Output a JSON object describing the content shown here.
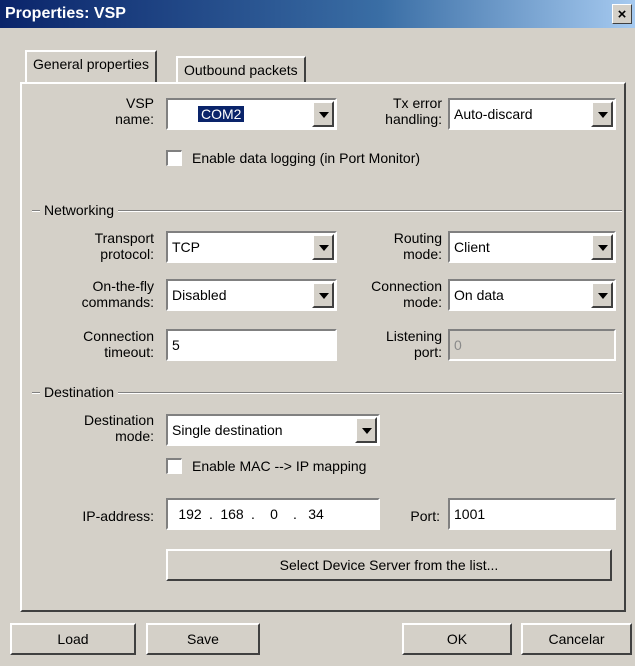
{
  "window": {
    "title": "Properties: VSP",
    "close_glyph": "×"
  },
  "tabs": [
    {
      "label": "General properties",
      "active": true
    },
    {
      "label": "Outbound packets",
      "active": false
    }
  ],
  "general": {
    "vsp_name_label_1": "VSP",
    "vsp_name_label_2": "name:",
    "vsp_name_value": "COM2",
    "tx_error_label_1": "Tx error",
    "tx_error_label_2": "handling:",
    "tx_error_value": "Auto-discard",
    "logging_label": "Enable data logging (in Port Monitor)",
    "logging_checked": false
  },
  "networking": {
    "section_title": "Networking",
    "transport_label_1": "Transport",
    "transport_label_2": "protocol:",
    "transport_value": "TCP",
    "routing_label_1": "Routing",
    "routing_label_2": "mode:",
    "routing_value": "Client",
    "onthefly_label_1": "On-the-fly",
    "onthefly_label_2": "commands:",
    "onthefly_value": "Disabled",
    "connmode_label_1": "Connection",
    "connmode_label_2": "mode:",
    "connmode_value": "On data",
    "timeout_label_1": "Connection",
    "timeout_label_2": "timeout:",
    "timeout_value": "5",
    "listening_label_1": "Listening",
    "listening_label_2": "port:",
    "listening_value": "0"
  },
  "destination": {
    "section_title": "Destination",
    "mode_label_1": "Destination",
    "mode_label_2": "mode:",
    "mode_value": "Single destination",
    "mac_label": "Enable MAC --> IP mapping",
    "mac_checked": false,
    "ip_label": "IP-address:",
    "ip_octets": [
      "192",
      "168",
      "0",
      "34"
    ],
    "ip_sep": ".",
    "port_label": "Port:",
    "port_value": "1001",
    "select_button": "Select Device Server from the list..."
  },
  "footer": {
    "load": "Load",
    "save": "Save",
    "ok": "OK",
    "cancel": "Cancelar"
  }
}
